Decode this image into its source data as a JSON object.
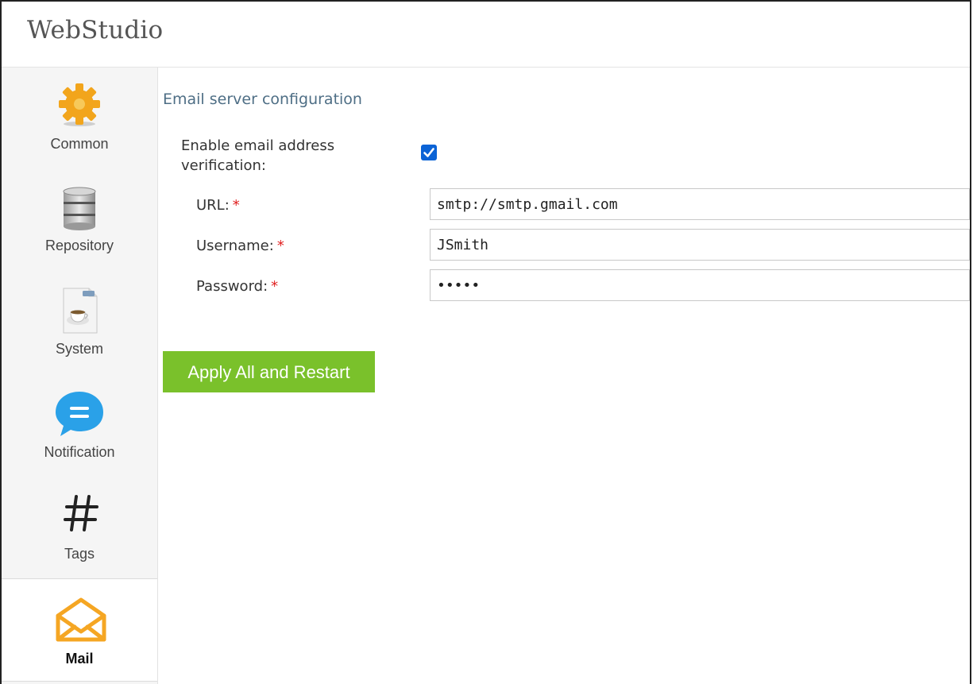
{
  "app": {
    "title": "WebStudio"
  },
  "sidebar": {
    "items": [
      {
        "label": "Common",
        "icon": "gear-icon"
      },
      {
        "label": "Repository",
        "icon": "database-icon"
      },
      {
        "label": "System",
        "icon": "java-icon"
      },
      {
        "label": "Notification",
        "icon": "chat-bubble-icon"
      },
      {
        "label": "Tags",
        "icon": "hash-icon"
      },
      {
        "label": "Mail",
        "icon": "envelope-icon",
        "active": true
      }
    ]
  },
  "main": {
    "section_title": "Email server configuration",
    "verification": {
      "label": "Enable email address verification:",
      "checked": true
    },
    "fields": [
      {
        "label": "URL:",
        "value": "smtp://smtp.gmail.com",
        "required": true
      },
      {
        "label": "Username:",
        "value": "JSmith",
        "required": true
      },
      {
        "label": "Password:",
        "value": "•••••",
        "required": true
      }
    ],
    "required_mark": "*",
    "apply_button": "Apply All and Restart"
  },
  "colors": {
    "accent_green": "#7ac12b",
    "section_title": "#4e6e85",
    "checkbox_blue": "#0b63d6",
    "required_red": "#e02020",
    "gear_orange": "#f2a51c",
    "notification_blue": "#2aa1e8",
    "mail_orange": "#f5a623"
  }
}
